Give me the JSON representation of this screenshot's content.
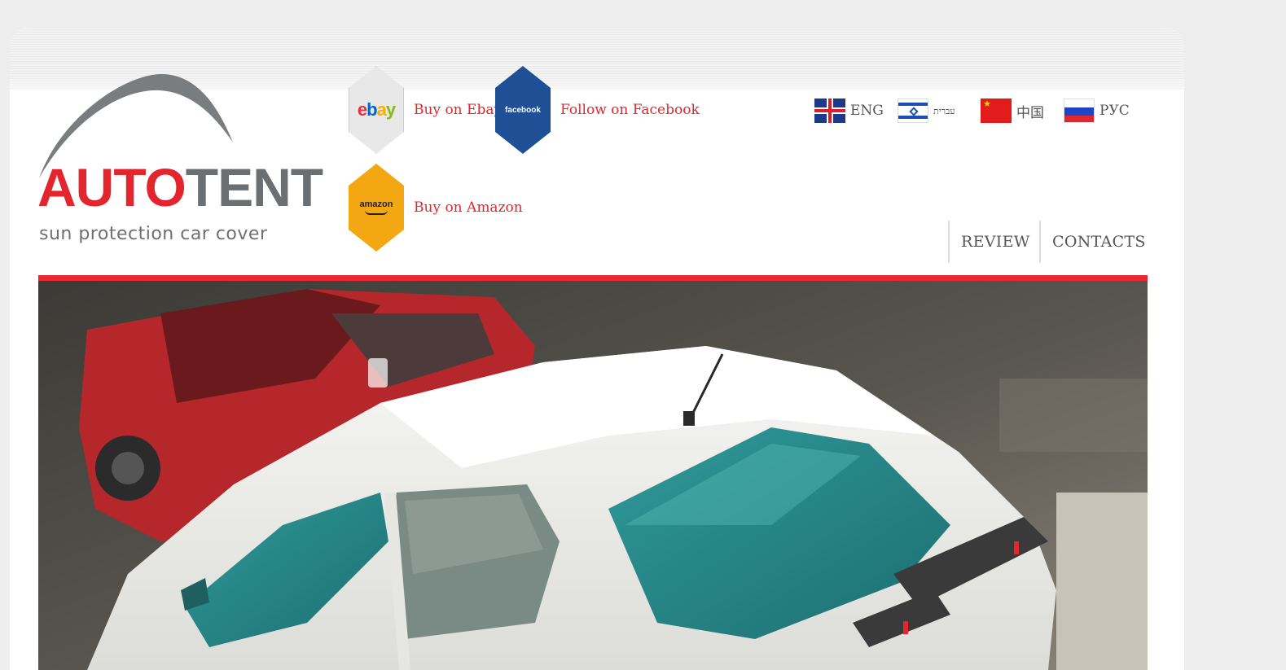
{
  "logo": {
    "word_auto": "AUTO",
    "word_tent": "TENT",
    "tagline": "sun protection car cover"
  },
  "shops": [
    {
      "id": "ebay",
      "label": "Buy on Ebay",
      "icon": "ebay-hex-icon",
      "icon_text": [
        "e",
        "b",
        "a",
        "y"
      ]
    },
    {
      "id": "facebook",
      "label": "Follow on Facebook",
      "icon": "facebook-hex-icon",
      "icon_text": "facebook"
    },
    {
      "id": "amazon",
      "label": "Buy on Amazon",
      "icon": "amazon-hex-icon",
      "icon_text": "amazon"
    }
  ],
  "languages": [
    {
      "code": "en",
      "label": "ENG",
      "icon": "uk-flag-icon"
    },
    {
      "code": "he",
      "label": "עברית",
      "icon": "israel-flag-icon"
    },
    {
      "code": "zh",
      "label": "中国",
      "icon": "china-flag-icon"
    },
    {
      "code": "ru",
      "label": "РУС",
      "icon": "russia-flag-icon"
    }
  ],
  "nav": {
    "review": "REVIEW",
    "contacts": "CONTACTS"
  },
  "colors": {
    "brand_red": "#e3262d",
    "brand_gray": "#6b6f72",
    "facebook_blue": "#1f4f94",
    "amazon_orange": "#f3a712"
  },
  "hero": {
    "image": "hero-car-photo"
  }
}
